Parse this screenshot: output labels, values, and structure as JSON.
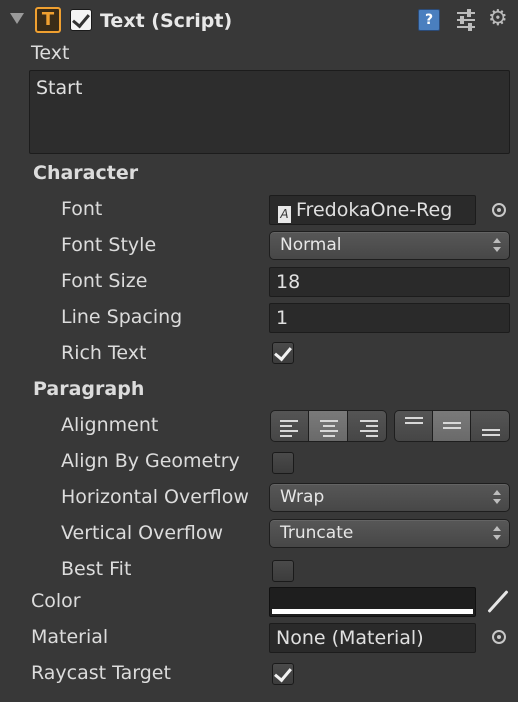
{
  "header": {
    "title": "Text (Script)",
    "enabled": true
  },
  "text_section": {
    "label": "Text",
    "value": "Start"
  },
  "character": {
    "heading": "Character",
    "font": {
      "label": "Font",
      "value": "FredokaOne-Reg"
    },
    "font_style": {
      "label": "Font Style",
      "value": "Normal"
    },
    "font_size": {
      "label": "Font Size",
      "value": "18"
    },
    "line_spacing": {
      "label": "Line Spacing",
      "value": "1"
    },
    "rich_text": {
      "label": "Rich Text",
      "checked": true
    }
  },
  "paragraph": {
    "heading": "Paragraph",
    "alignment": {
      "label": "Alignment",
      "horizontal_selected": "center",
      "vertical_selected": "middle"
    },
    "align_by_geometry": {
      "label": "Align By Geometry",
      "checked": false
    },
    "horizontal_overflow": {
      "label": "Horizontal Overflow",
      "value": "Wrap"
    },
    "vertical_overflow": {
      "label": "Vertical Overflow",
      "value": "Truncate"
    },
    "best_fit": {
      "label": "Best Fit",
      "checked": false
    }
  },
  "color": {
    "label": "Color",
    "swatch": "#ffffff"
  },
  "material": {
    "label": "Material",
    "value": "None (Material)"
  },
  "raycast_target": {
    "label": "Raycast Target",
    "checked": true
  },
  "colors": {
    "panel_bg": "#383838",
    "icon_orange": "#f0a030",
    "help_blue": "#4a7fbf"
  }
}
